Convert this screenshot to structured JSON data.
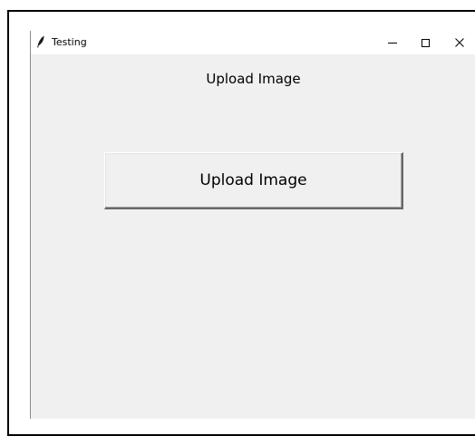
{
  "window": {
    "title": "Testing",
    "controls": {
      "minimize_icon": "minimize-icon",
      "maximize_icon": "maximize-icon",
      "close_icon": "close-icon",
      "close_glyph": "✕"
    }
  },
  "main": {
    "heading": "Upload Image",
    "upload_button_label": "Upload Image"
  },
  "colors": {
    "window_background": "#f0f0f0",
    "titlebar_background": "#ffffff"
  }
}
